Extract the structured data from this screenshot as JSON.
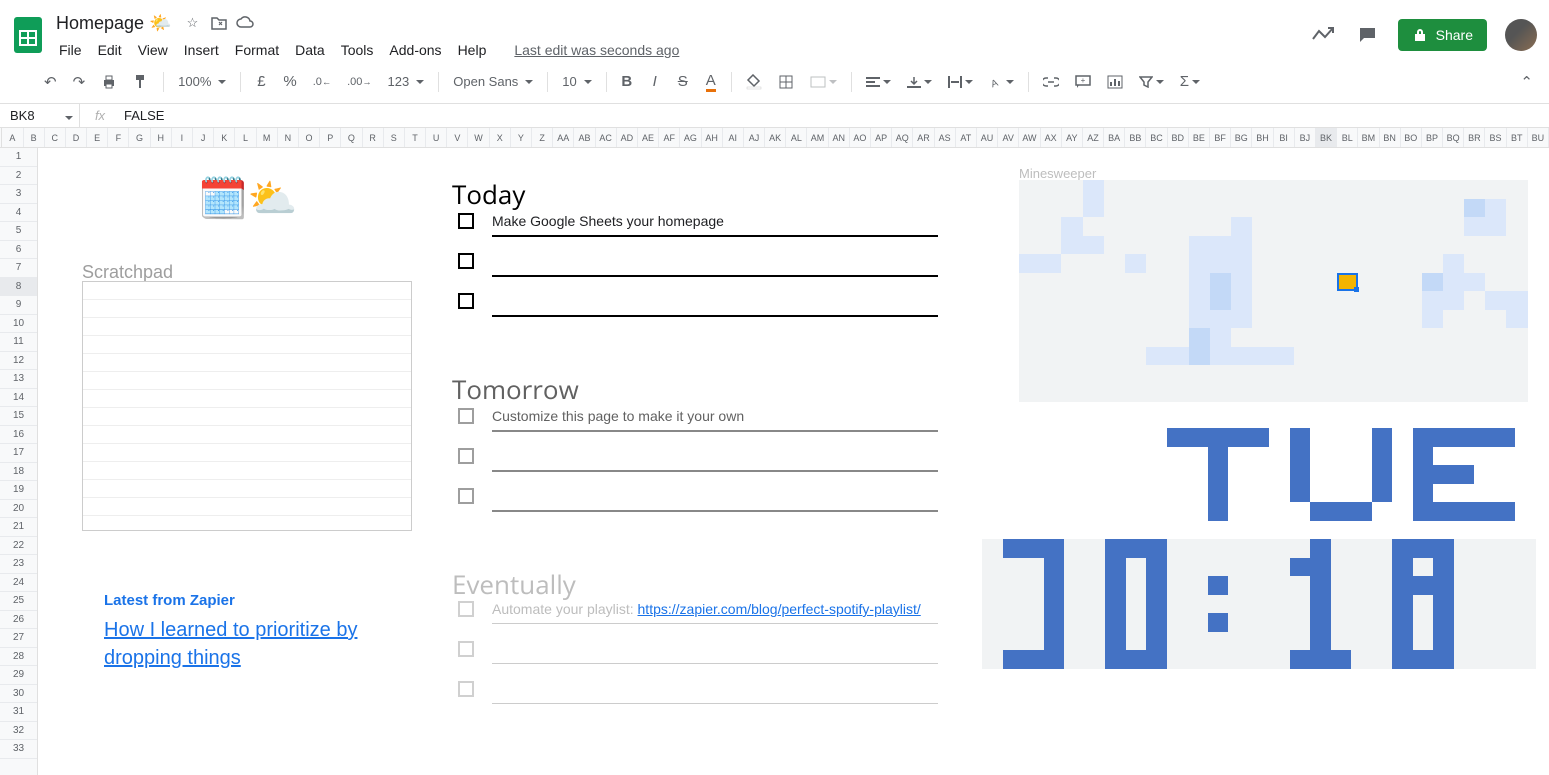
{
  "doc": {
    "title": "Homepage",
    "title_emoji": "🌤️",
    "last_edit": "Last edit was seconds ago"
  },
  "menubar": [
    "File",
    "Edit",
    "View",
    "Insert",
    "Format",
    "Data",
    "Tools",
    "Add-ons",
    "Help"
  ],
  "toolbar": {
    "zoom": "100%",
    "currency": "£",
    "percent": "%",
    "font": "Open Sans",
    "font_size": "10"
  },
  "share_label": "Share",
  "name_box": "BK8",
  "formula": "FALSE",
  "columns": [
    "A",
    "B",
    "C",
    "D",
    "E",
    "F",
    "G",
    "H",
    "I",
    "J",
    "K",
    "L",
    "M",
    "N",
    "O",
    "P",
    "Q",
    "R",
    "S",
    "T",
    "U",
    "V",
    "W",
    "X",
    "Y",
    "Z",
    "AA",
    "AB",
    "AC",
    "AD",
    "AE",
    "AF",
    "AG",
    "AH",
    "AI",
    "AJ",
    "AK",
    "AL",
    "AM",
    "AN",
    "AO",
    "AP",
    "AQ",
    "AR",
    "AS",
    "AT",
    "AU",
    "AV",
    "AW",
    "AX",
    "AY",
    "AZ",
    "BA",
    "BB",
    "BC",
    "BD",
    "BE",
    "BF",
    "BG",
    "BH",
    "BI",
    "BJ",
    "BK",
    "BL",
    "BM",
    "BN",
    "BO",
    "BP",
    "BQ",
    "BR",
    "BS",
    "BT",
    "BU"
  ],
  "rows": 33,
  "active_row": 8,
  "emojis": {
    "calendar": "🗓️",
    "weather": "⛅"
  },
  "scratchpad_label": "Scratchpad",
  "blog": {
    "heading": "Latest from Zapier",
    "title": "How I learned to prioritize by dropping things"
  },
  "sections": {
    "today": "Today",
    "tomorrow": "Tomorrow",
    "eventually": "Eventually"
  },
  "tasks": {
    "today": [
      "Make Google Sheets your homepage",
      "",
      ""
    ],
    "tomorrow": [
      "Customize this page to make it your own",
      "",
      ""
    ],
    "eventually_prefix": "Automate your playlist: ",
    "eventually_link": "https://zapier.com/blog/perfect-spotify-playlist/",
    "eventually_rest": [
      "",
      ""
    ]
  },
  "minesweeper_label": "Minesweeper",
  "clock_day": "TUE",
  "clock_time": "10:18"
}
